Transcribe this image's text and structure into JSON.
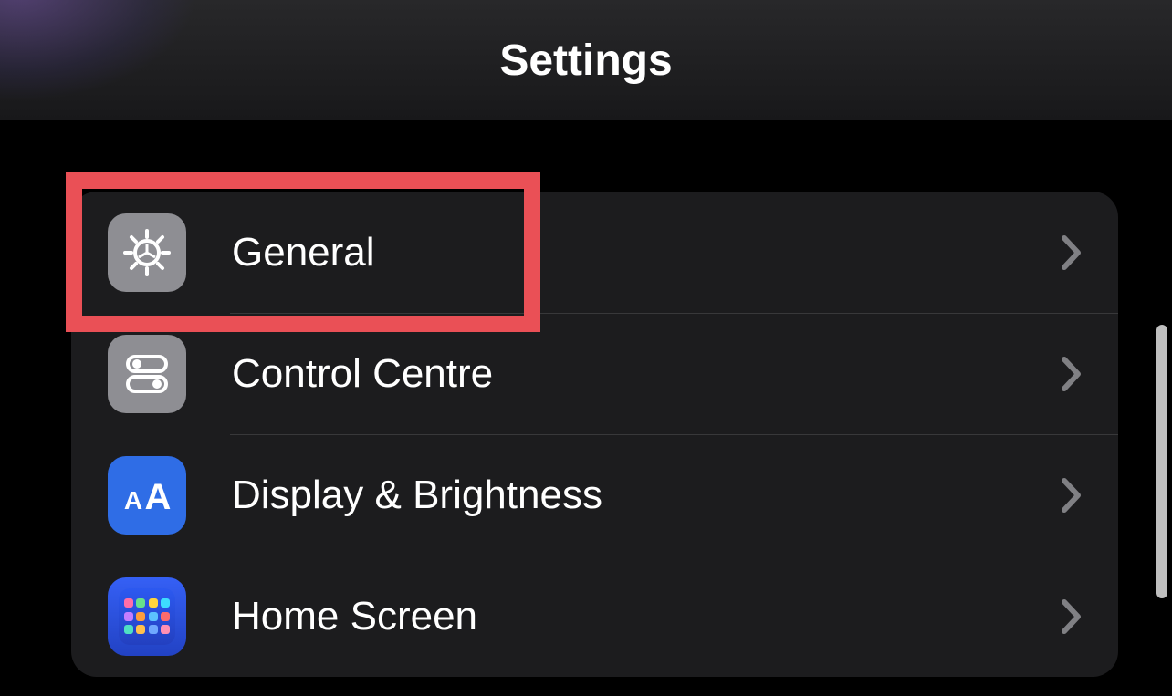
{
  "header": {
    "title": "Settings"
  },
  "icons": {
    "gray": "#8e8e93",
    "blue": "#2f6de6",
    "homescreen_bg": "#2d5af0"
  },
  "rows": [
    {
      "id": "general",
      "label": "General",
      "icon": "gear",
      "icon_bg": "gray",
      "highlighted": true
    },
    {
      "id": "control",
      "label": "Control Centre",
      "icon": "toggles",
      "icon_bg": "gray",
      "highlighted": false
    },
    {
      "id": "display",
      "label": "Display & Brightness",
      "icon": "aa",
      "icon_bg": "blue",
      "highlighted": false
    },
    {
      "id": "homescreen",
      "label": "Home Screen",
      "icon": "homescreen",
      "icon_bg": "blue",
      "highlighted": false
    }
  ],
  "homescreen_colors": [
    "#ff6ea8",
    "#67e28b",
    "#ffd43c",
    "#3ddcff",
    "#c47dff",
    "#ff9d3c",
    "#5cc2ff",
    "#ff6b6b",
    "#4fe0c3",
    "#ffc04d",
    "#6fa8ff",
    "#ff8fb3"
  ]
}
